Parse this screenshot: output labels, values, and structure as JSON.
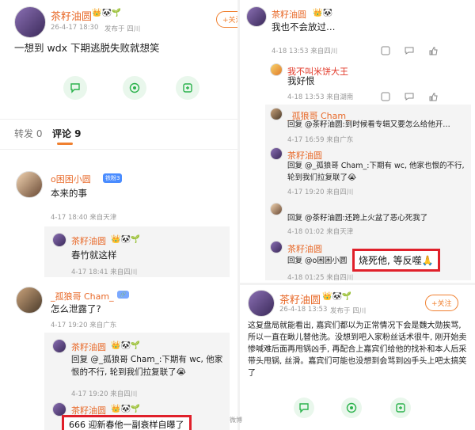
{
  "colors": {
    "accent": "#f08030",
    "name": "#e86a2a",
    "highlight": "#e0202a",
    "action": "#2bb24c"
  },
  "left": {
    "post": {
      "author": "茶籽油圆",
      "author_emojis": "👑🐼🌱",
      "date": "26-4-17 18:30",
      "source": "发布于 四川",
      "follow": "+关注",
      "body": "一想到 wdx 下期逃脱失败就想笑"
    },
    "tabs": {
      "forward": "转发 0",
      "comment": "评论 9"
    },
    "comments": [
      {
        "name": "o困困小圆",
        "badge": "铁粉3",
        "body": "本来的事",
        "meta": "4-17 18:40  来自天津",
        "reply": {
          "name": "茶籽油圆",
          "emojis": "👑🐼🌱",
          "body": "春竹就这样",
          "meta": "4-17 18:41  来自四川"
        }
      },
      {
        "name": "_孤狼哥 Cham_",
        "badge": "🔗",
        "body": "怎么泄露了?",
        "meta": "4-17 19:20  来自广东",
        "reply": {
          "name": "茶籽油圆",
          "emojis": "👑🐼🌱",
          "body": "回复 @_孤狼哥 Cham_:下期有 wc, 他家恨的不行, 轮到我们拉复联了😭",
          "meta": "4-17 19:20  来自四川"
        }
      }
    ],
    "last_reply": {
      "name": "茶籽油圆",
      "emojis": "👑🐼🌱",
      "boxed": "666 迎新春他一副衰样自曝了"
    }
  },
  "right_top": {
    "main": {
      "name": "茶籽油圆",
      "badge": "👑🐼",
      "body": "我也不会放过…",
      "meta": "4-18 13:53  来自四川"
    },
    "reply1": {
      "name": "我不叫米饼大王",
      "body": "我好恨",
      "meta": "4-18 13:53  来自湖南"
    },
    "reply2": {
      "name": "_孤狼哥 Cham_",
      "body": "回复 @茶籽油圆:到时候看专辑又要怎么给他开…",
      "meta": "4-17 16:59  来自广东"
    },
    "reply3": {
      "name": "茶籽油圆",
      "body": "回复 @_孤狼哥 Cham_:下期有 wc, 他家也恨的不行, 轮到我们拉复联了😭",
      "meta": "4-17 19:20  来自四川"
    },
    "reply4": {
      "name": "o困困小圆",
      "body": "回复 @茶籽油圆:还跨上火盆了恶心死我了",
      "meta": "4-18 01:02  来自天津"
    },
    "reply5": {
      "name": "茶籽油圆",
      "body_prefix": "回复 @o困困小圆",
      "boxed": "烧死他, 等反噬🙏",
      "meta": "4-18 01:25  来自四川"
    }
  },
  "right_bot": {
    "name": "茶籽油圆",
    "emojis": "👑🐼🌱",
    "date": "26-4-18 13:53",
    "source": "发布于 四川",
    "follow": "+关注",
    "body": "这复盘局就能看出, 嘉宾们都以为正常情况下会是魏大勋挨骂, 所以一直在瞅儿替他洗。没想到吧入家粉丝话术很牛, 刚开始卖惨喊难后面再甩锅凶手, 再配合上嘉宾们给他的找补和本人后采带头甩锅, 丝滑。嘉宾们可能也没想到会骂到凶手头上吧太搞笑了"
  },
  "watermark": "微博"
}
